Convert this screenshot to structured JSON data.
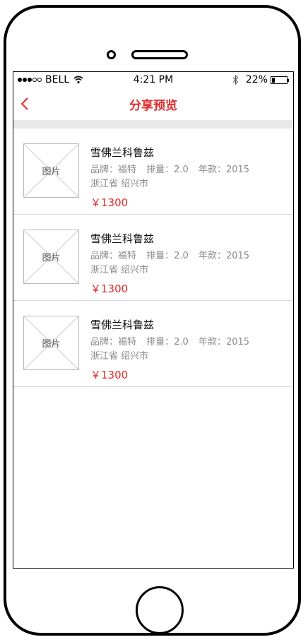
{
  "status_bar": {
    "signal_dots": [
      true,
      true,
      true,
      false,
      false
    ],
    "carrier": "BELL",
    "time": "4:21 PM",
    "battery_percent_label": "22%",
    "battery_level": 0.22
  },
  "nav": {
    "title": "分享预览",
    "back_icon": "chevron-left-icon"
  },
  "colors": {
    "accent": "#e4292b",
    "divider": "#d9d9d9",
    "band": "#e8e8e8"
  },
  "list": {
    "items": [
      {
        "thumb_label": "图片",
        "title": "雪佛兰科鲁兹",
        "brand": "品牌：福特",
        "displacement": "排量：2.0",
        "year": "年款：2015",
        "location": "浙江省 绍兴市",
        "price": "￥1300"
      },
      {
        "thumb_label": "图片",
        "title": "雪佛兰科鲁兹",
        "brand": "品牌：福特",
        "displacement": "排量：2.0",
        "year": "年款：2015",
        "location": "浙江省 绍兴市",
        "price": "￥1300"
      },
      {
        "thumb_label": "图片",
        "title": "雪佛兰科鲁兹",
        "brand": "品牌：福特",
        "displacement": "排量：2.0",
        "year": "年款：2015",
        "location": "浙江省 绍兴市",
        "price": "￥1300"
      }
    ]
  }
}
